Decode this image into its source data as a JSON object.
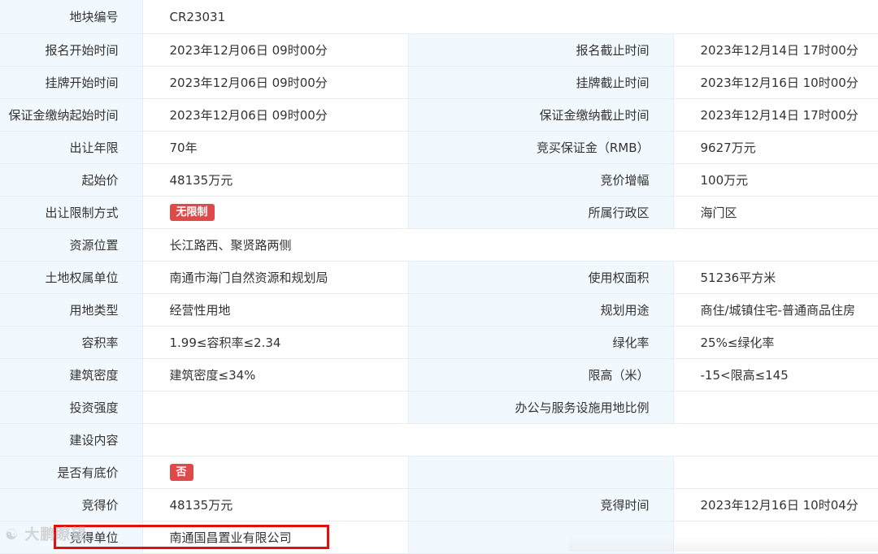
{
  "rows": [
    {
      "l1": "地块编号",
      "v1": "CR23031",
      "l2": "",
      "v2": ""
    },
    {
      "l1": "报名开始时间",
      "v1": "2023年12月06日 09时00分",
      "l2": "报名截止时间",
      "v2": "2023年12月14日 17时00分"
    },
    {
      "l1": "挂牌开始时间",
      "v1": "2023年12月06日 09时00分",
      "l2": "挂牌截止时间",
      "v2": "2023年12月16日 10时00分"
    },
    {
      "l1": "保证金缴纳起始时间",
      "v1": "2023年12月06日 09时00分",
      "l2": "保证金缴纳截止时间",
      "v2": "2023年12月14日 17时00分"
    },
    {
      "l1": "出让年限",
      "v1": "70年",
      "l2": "竞买保证金（RMB）",
      "v2": "9627万元"
    },
    {
      "l1": "起始价",
      "v1": "48135万元",
      "l2": "竞价增幅",
      "v2": "100万元"
    },
    {
      "l1": "出让限制方式",
      "v1": "无限制",
      "l2": "所属行政区",
      "v2": "海门区"
    },
    {
      "l1": "资源位置",
      "v1": "长江路西、聚贤路两侧",
      "l2": "",
      "v2": ""
    },
    {
      "l1": "土地权属单位",
      "v1": "南通市海门自然资源和规划局",
      "l2": "使用权面积",
      "v2": "51236平方米"
    },
    {
      "l1": "用地类型",
      "v1": "经营性用地",
      "l2": "规划用途",
      "v2": "商住/城镇住宅-普通商品住房"
    },
    {
      "l1": "容积率",
      "v1": "1.99≤容积率≤2.34",
      "l2": "绿化率",
      "v2": "25%≤绿化率"
    },
    {
      "l1": "建筑密度",
      "v1": "建筑密度≤34%",
      "l2": "限高（米）",
      "v2": "-15<限高≤145"
    },
    {
      "l1": "投资强度",
      "v1": "",
      "l2": "办公与服务设施用地比例",
      "v2": ""
    },
    {
      "l1": "建设内容",
      "v1": "",
      "l2": "",
      "v2": ""
    },
    {
      "l1": "是否有底价",
      "v1": "否",
      "l2": "",
      "v2": ""
    },
    {
      "l1": "竞得价",
      "v1": "48135万元",
      "l2": "竞得时间",
      "v2": "2023年12月16日 10时04分"
    },
    {
      "l1": "竞得单位",
      "v1": "南通国昌置业有限公司",
      "l2": "",
      "v2": ""
    }
  ],
  "watermark": "大鹏瞭望",
  "colors": {
    "label_bg": "#f1f8fe",
    "border": "#e6eef5",
    "badge_bg": "#e0494a",
    "highlight": "#e01010"
  }
}
